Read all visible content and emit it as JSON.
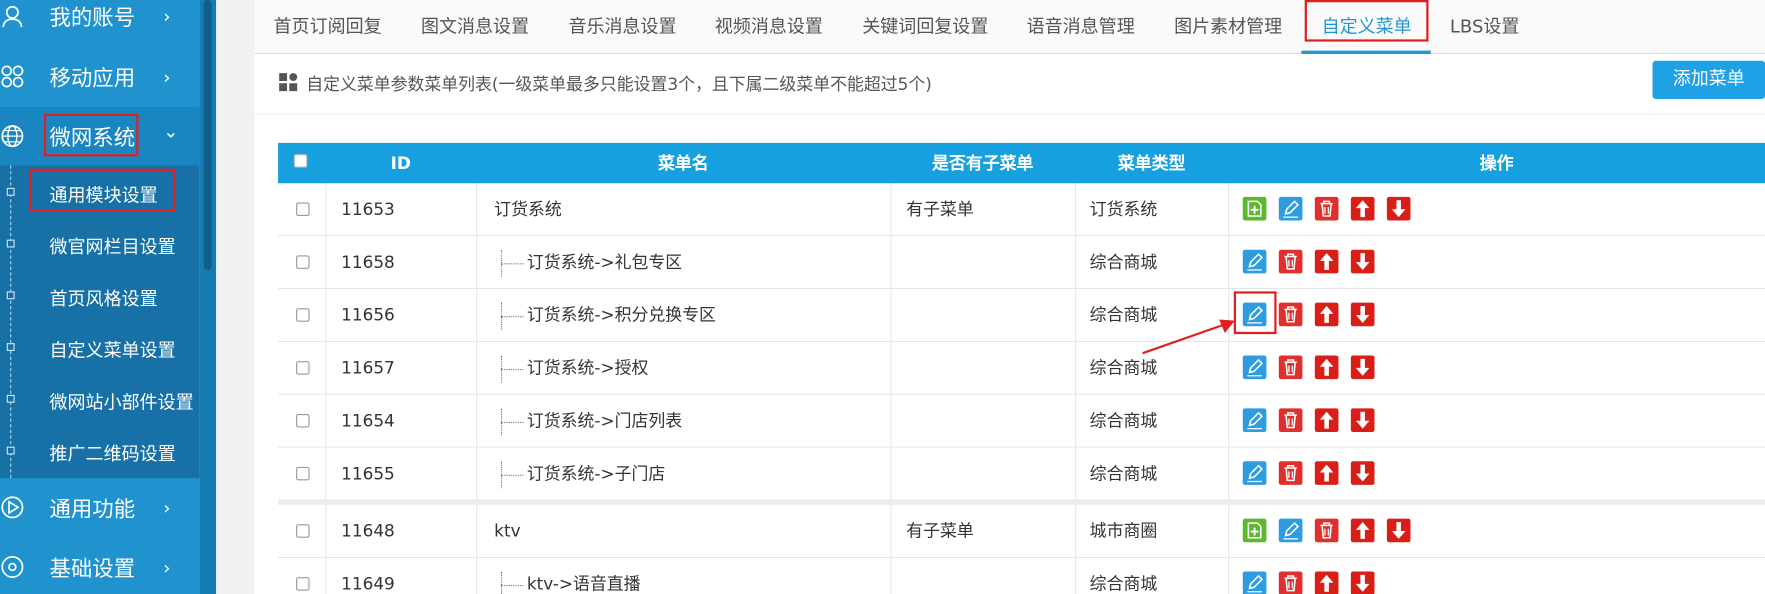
{
  "sidebar": {
    "main_items": [
      {
        "label": "我的账号",
        "icon": "user-icon",
        "chevron": "›"
      },
      {
        "label": "移动应用",
        "icon": "apps-icon",
        "chevron": "›"
      },
      {
        "label": "微网系统",
        "icon": "globe-icon",
        "chevron": "⌄"
      },
      {
        "label": "通用功能",
        "icon": "play-icon",
        "chevron": "›"
      },
      {
        "label": "基础设置",
        "icon": "settings-icon",
        "chevron": "›"
      }
    ],
    "sub_items": [
      {
        "label": "通用模块设置"
      },
      {
        "label": "微官网栏目设置"
      },
      {
        "label": "首页风格设置"
      },
      {
        "label": "自定义菜单设置"
      },
      {
        "label": "微网站小部件设置"
      },
      {
        "label": "推广二维码设置"
      }
    ]
  },
  "tabs": [
    {
      "label": "首页订阅回复"
    },
    {
      "label": "图文消息设置"
    },
    {
      "label": "音乐消息设置"
    },
    {
      "label": "视频消息设置"
    },
    {
      "label": "关键词回复设置"
    },
    {
      "label": "语音消息管理"
    },
    {
      "label": "图片素材管理"
    },
    {
      "label": "自定义菜单"
    },
    {
      "label": "LBS设置"
    }
  ],
  "info": {
    "text": "自定义菜单参数菜单列表(一级菜单最多只能设置3个，且下属二级菜单不能超过5个)",
    "add_button": "添加菜单"
  },
  "table": {
    "headers": {
      "id": "ID",
      "name": "菜单名",
      "has_sub": "是否有子菜单",
      "type": "菜单类型",
      "ops": "操作"
    },
    "rows": [
      {
        "id": "11653",
        "name": "订货系统",
        "has_sub": "有子菜单",
        "type": "订货系统",
        "child": false
      },
      {
        "id": "11658",
        "name": "订货系统->礼包专区",
        "has_sub": "",
        "type": "综合商城",
        "child": true
      },
      {
        "id": "11656",
        "name": "订货系统->积分兑换专区",
        "has_sub": "",
        "type": "综合商城",
        "child": true
      },
      {
        "id": "11657",
        "name": "订货系统->授权",
        "has_sub": "",
        "type": "综合商城",
        "child": true
      },
      {
        "id": "11654",
        "name": "订货系统->门店列表",
        "has_sub": "",
        "type": "综合商城",
        "child": true
      },
      {
        "id": "11655",
        "name": "订货系统->子门店",
        "has_sub": "",
        "type": "综合商城",
        "child": true
      },
      {
        "id": "11648",
        "name": "ktv",
        "has_sub": "有子菜单",
        "type": "城市商圈",
        "child": false
      },
      {
        "id": "11649",
        "name": "ktv->语音直播",
        "has_sub": "",
        "type": "综合商城",
        "child": true
      }
    ]
  },
  "colors": {
    "sidebar": "#2093cf",
    "accent": "#2196d3",
    "highlight": "#e02020"
  }
}
